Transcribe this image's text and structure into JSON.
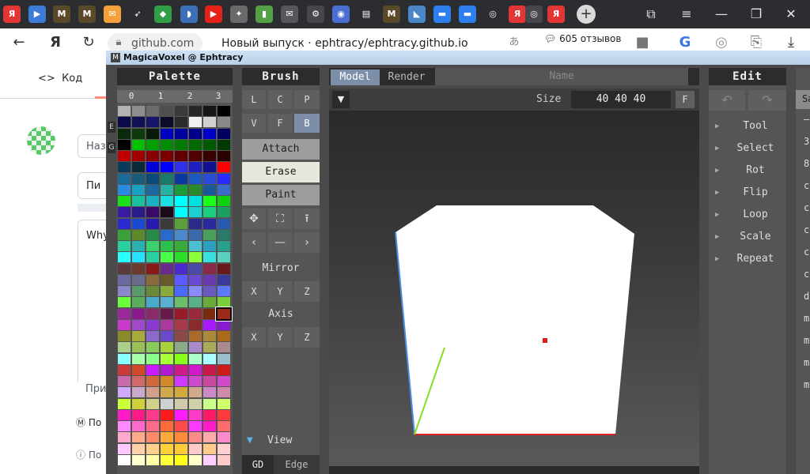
{
  "browser": {
    "tabs": [
      {
        "icon": "yandex-icon",
        "glyph": "Я",
        "color": "#e23636"
      },
      {
        "icon": "video-icon",
        "glyph": "▶",
        "color": "#3d7bd9"
      },
      {
        "icon": "app-m-icon",
        "glyph": "M",
        "color": "#5a4a2a"
      },
      {
        "icon": "app-m-icon",
        "glyph": "M",
        "color": "#5a4a2a"
      },
      {
        "icon": "mail-icon",
        "glyph": "✉",
        "color": "#f4a13a"
      },
      {
        "icon": "feather-icon",
        "glyph": "➶",
        "color": "#2b2d31"
      },
      {
        "icon": "shield-icon",
        "glyph": "◆",
        "color": "#2f9e44"
      },
      {
        "icon": "python-icon",
        "glyph": "◗",
        "color": "#3b6fb6"
      },
      {
        "icon": "youtube-icon",
        "glyph": "▶",
        "color": "#e62117"
      },
      {
        "icon": "emblem-icon",
        "glyph": "✦",
        "color": "#6a6a6a"
      },
      {
        "icon": "book-icon",
        "glyph": "▮",
        "color": "#53a046"
      },
      {
        "icon": "mail-grey-icon",
        "glyph": "✉",
        "color": "#55575c"
      },
      {
        "icon": "settings-page-icon",
        "glyph": "⚙",
        "color": "#45474d"
      },
      {
        "icon": "circle-icon",
        "glyph": "◉",
        "color": "#4a6fd0"
      },
      {
        "icon": "doc-icon",
        "glyph": "▤",
        "color": "#2b2d31"
      },
      {
        "icon": "app-m-icon",
        "glyph": "M",
        "color": "#5a4a2a"
      },
      {
        "icon": "dolphin-icon",
        "glyph": "◣",
        "color": "#4a86c8"
      },
      {
        "icon": "chat-icon",
        "glyph": "▬",
        "color": "#2d7ff0"
      },
      {
        "icon": "chat-icon",
        "glyph": "▬",
        "color": "#2d7ff0"
      },
      {
        "icon": "github-icon",
        "glyph": "◎",
        "color": "#2b2d31"
      },
      {
        "icon": "yandex-icon",
        "glyph": "Я",
        "color": "#e23636"
      },
      {
        "icon": "github-icon",
        "glyph": "◎",
        "color": "#45474d"
      },
      {
        "icon": "yandex-icon",
        "glyph": "Я",
        "color": "#e23636"
      }
    ],
    "newtab": "+",
    "url": "github.com",
    "page_title": "Новый выпуск · ephtracy/ephtracy.github.io",
    "reviews": "605 отзывов"
  },
  "github": {
    "code_tab": "Код",
    "input1": "Наз",
    "input2": "Пи",
    "input3": "Why",
    "input4": "При",
    "bottom1": "По",
    "bottom2": "По"
  },
  "mv": {
    "title": "MagicaVoxel @ Ephtracy",
    "palette": {
      "title": "Palette",
      "cols": [
        "0",
        "1",
        "2",
        "3"
      ],
      "side": [
        "E",
        "G"
      ]
    },
    "brush": {
      "title": "Brush",
      "row1": [
        "L",
        "C",
        "P"
      ],
      "row2": [
        "V",
        "F",
        "B"
      ],
      "modes": [
        "Attach",
        "Erase",
        "Paint"
      ],
      "tools1": [
        "✥",
        "⛶",
        "⭱"
      ],
      "tools2": [
        "‹",
        "—",
        "›"
      ],
      "mirror_label": "Mirror",
      "mirror": [
        "X",
        "Y",
        "Z"
      ],
      "axis_label": "Axis",
      "axis": [
        "X",
        "Y",
        "Z"
      ],
      "view_label": "View",
      "view_tabs": [
        "GD",
        "Edge"
      ]
    },
    "viewport": {
      "tab_model": "Model",
      "tab_render": "Render",
      "name_placeholder": "Name",
      "size_label": "Size",
      "size_value": "40 40 40",
      "size_button": "F"
    },
    "edit": {
      "title": "Edit",
      "items": [
        "Tool",
        "Select",
        "Rot",
        "Flip",
        "Loop",
        "Scale",
        "Repeat"
      ]
    },
    "right_partial": [
      "Sa",
      "–",
      "3",
      "8",
      "c",
      "c",
      "c",
      "c",
      "c",
      "d",
      "m",
      "m",
      "m",
      "m"
    ]
  },
  "palette_colors": [
    "#b3b3b3",
    "#8d8d8d",
    "#6b6b6b",
    "#4f4f4f",
    "#3a3a3a",
    "#262626",
    "#161616",
    "#000000",
    "#0a0a4a",
    "#101055",
    "#15156a",
    "#0c0c2a",
    "#2a2a2a",
    "#f0f0f0",
    "#d0d0d0",
    "#8a8a8a",
    "#0b2a0b",
    "#0d3a0d",
    "#0a1a0a",
    "#0000c0",
    "#0000a0",
    "#00008a",
    "#0000c8",
    "#000060",
    "#000000",
    "#00c000",
    "#00a000",
    "#008c00",
    "#007a00",
    "#006a00",
    "#005a00",
    "#003a00",
    "#c00000",
    "#a00000",
    "#8a0000",
    "#7a0000",
    "#600000",
    "#500000",
    "#3a0000",
    "#2a0000",
    "#0c3a5a",
    "#0a2a3a",
    "#0000d8",
    "#0000ff",
    "#3030e8",
    "#2020c0",
    "#101090",
    "#ff0000",
    "#1a6a9a",
    "#1a5a7a",
    "#0a4a7a",
    "#1a7a6a",
    "#0a3aa0",
    "#1a5ac0",
    "#2a4ad8",
    "#2a2aff",
    "#2a8ae0",
    "#1aa0c0",
    "#1a6aa0",
    "#2ab0a0",
    "#1a9a3a",
    "#2a8a2a",
    "#1a5a9a",
    "#3a6aca",
    "#1ae01a",
    "#1ac0a0",
    "#1ab0c0",
    "#1ae0e0",
    "#00ffff",
    "#00e0e0",
    "#1aff1a",
    "#10d010",
    "#3a1aa0",
    "#2a1a8a",
    "#3a0a6a",
    "#1a0a1a",
    "#00ffff",
    "#1ad0d0",
    "#1ad080",
    "#1aa060",
    "#2a2ad0",
    "#1a4ad0",
    "#2a1ab0",
    "#3a3a3a",
    "#5aa03a",
    "#2a2a8a",
    "#2a2aa0",
    "#2a5ab0",
    "#3aa03a",
    "#5a8a2a",
    "#2a8a4a",
    "#2a6aca",
    "#4a8aca",
    "#3a6aaa",
    "#4aa05a",
    "#2a7a6a",
    "#2ad0a0",
    "#2ab0b0",
    "#3ad06a",
    "#2ac04a",
    "#3aaa3a",
    "#4ac0d0",
    "#2aa0c0",
    "#2aa08a",
    "#2affff",
    "#2ae0ff",
    "#2ad0a0",
    "#4aff4a",
    "#2ae02a",
    "#8aff3a",
    "#3ae0e0",
    "#5ad0c0",
    "#5a3a3a",
    "#6a3a2a",
    "#8a1a1a",
    "#6a2a8a",
    "#4a2ad0",
    "#4a4aaa",
    "#8a2a4a",
    "#6a1a1a",
    "#6a6aa0",
    "#6a6a8a",
    "#8a6a3a",
    "#6a5a2a",
    "#5a5aff",
    "#6a4ad0",
    "#6a3ab0",
    "#3a3a9a",
    "#8a8aca",
    "#5a9a6a",
    "#6a8a3a",
    "#8aaa3a",
    "#4a6aff",
    "#8a8aff",
    "#6a5ac0",
    "#5a7aff",
    "#6aff3a",
    "#5ab05a",
    "#4aaaca",
    "#5ab0d0",
    "#6ac06a",
    "#5ab08a",
    "#6aaa3a",
    "#7ad03a",
    "#9a2a9a",
    "#8a1a8a",
    "#8a2a6a",
    "#6a1a4a",
    "#9a1a2a",
    "#9a2a3a",
    "#7a2a0a",
    "#9a2a1a",
    "#ca3aca",
    "#a04aca",
    "#8a3ad0",
    "#aa3aa0",
    "#aa3a4a",
    "#8a2a2a",
    "#aa1aff",
    "#8a1ad0",
    "#8a8a2a",
    "#aaaa3a",
    "#8a6aca",
    "#6a4aca",
    "#8a4a4a",
    "#aa6a2a",
    "#aa8a3a",
    "#aa6a1a",
    "#aad08a",
    "#9ac05a",
    "#8aca5a",
    "#aad03a",
    "#8aaa8a",
    "#aa8aca",
    "#aaaa5a",
    "#aa8a8a",
    "#8affff",
    "#aaffaa",
    "#8aff8a",
    "#aaff3a",
    "#8aff1a",
    "#aaffca",
    "#aaffff",
    "#9ac0d0",
    "#ca3a3a",
    "#d04a2a",
    "#ca1aff",
    "#b01ad0",
    "#d01a8a",
    "#d01aca",
    "#ca1a4a",
    "#d01a1a",
    "#ca6aaa",
    "#d06a6a",
    "#d06a3a",
    "#d08a2a",
    "#d03aff",
    "#d04ad0",
    "#ca4aa0",
    "#d04aca",
    "#d0aaff",
    "#caaaca",
    "#d0a08a",
    "#d0aa4a",
    "#d0aa3a",
    "#d0aa8a",
    "#ca8aca",
    "#d08aaa",
    "#caff3a",
    "#d0d03a",
    "#d0d08a",
    "#d0d0d0",
    "#d0caaa",
    "#d0d0aa",
    "#caff8a",
    "#d0ff6a",
    "#ff1aca",
    "#ff1a8a",
    "#ff3a8a",
    "#ff1a1a",
    "#ff1aff",
    "#ff3aca",
    "#ff1a6a",
    "#ff3a3a",
    "#ff8aff",
    "#ff6aca",
    "#ff6a8a",
    "#ff6a3a",
    "#ff4a4a",
    "#ff3aff",
    "#ff1aca",
    "#ff6a6a",
    "#ffaaca",
    "#ffaa8a",
    "#ff8a6a",
    "#ffaa3a",
    "#ff8a3a",
    "#ff8a8a",
    "#ffaaaa",
    "#ff8aca",
    "#ffcaff",
    "#ffd0aa",
    "#ffd08a",
    "#ffd03a",
    "#ffca3a",
    "#ffcaca",
    "#ffca8a",
    "#ffd0d0",
    "#ffffff",
    "#ffffd0",
    "#ffffaa",
    "#ffff3a",
    "#ffff1a",
    "#ffffca",
    "#ffd0ff",
    "#ffcaca"
  ],
  "selected_swatch": 151
}
